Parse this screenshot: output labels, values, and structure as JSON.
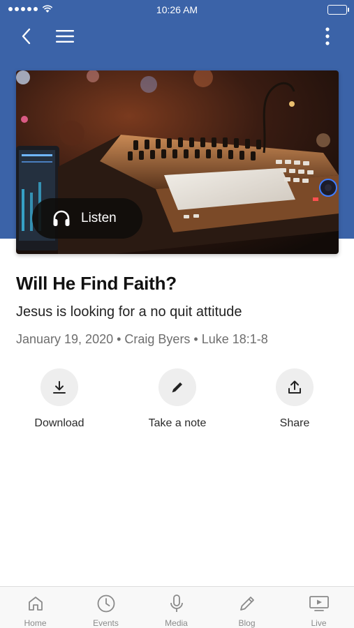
{
  "status_bar": {
    "time": "10:26 AM"
  },
  "nav": {
    "back_icon": "chevron-left-icon",
    "menu_icon": "hamburger-icon",
    "more_icon": "more-vertical-icon"
  },
  "hero": {
    "image_description_icon": "audio-mixer-photo",
    "listen_label": "Listen"
  },
  "sermon": {
    "title": "Will He Find Faith?",
    "subtitle": "Jesus is looking for a no quit attitude",
    "meta": "January 19, 2020 • Craig Byers • Luke 18:1-8"
  },
  "actions": [
    {
      "label": "Download",
      "icon": "download-icon"
    },
    {
      "label": "Take a note",
      "icon": "pencil-icon"
    },
    {
      "label": "Share",
      "icon": "share-icon"
    }
  ],
  "tabs": [
    {
      "label": "Home",
      "icon": "home-icon"
    },
    {
      "label": "Events",
      "icon": "clock-icon"
    },
    {
      "label": "Media",
      "icon": "microphone-icon"
    },
    {
      "label": "Blog",
      "icon": "pencil-icon"
    },
    {
      "label": "Live",
      "icon": "tv-icon"
    }
  ],
  "colors": {
    "header_blue": "#3b63a8",
    "tab_gray": "#8a8a8a",
    "action_circle": "#eeeeee"
  }
}
